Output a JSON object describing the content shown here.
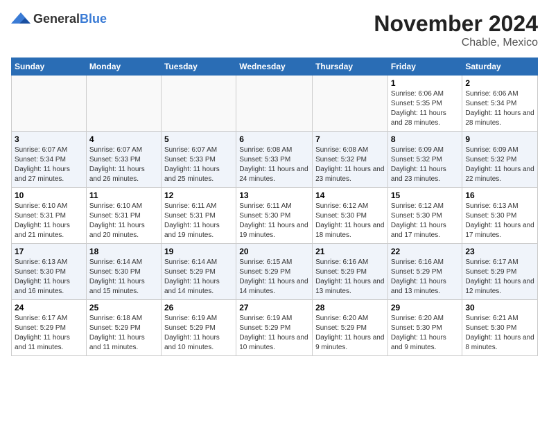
{
  "header": {
    "logo_general": "General",
    "logo_blue": "Blue",
    "month_year": "November 2024",
    "location": "Chable, Mexico"
  },
  "weekdays": [
    "Sunday",
    "Monday",
    "Tuesday",
    "Wednesday",
    "Thursday",
    "Friday",
    "Saturday"
  ],
  "weeks": [
    [
      {
        "day": "",
        "sunrise": "",
        "sunset": "",
        "daylight": ""
      },
      {
        "day": "",
        "sunrise": "",
        "sunset": "",
        "daylight": ""
      },
      {
        "day": "",
        "sunrise": "",
        "sunset": "",
        "daylight": ""
      },
      {
        "day": "",
        "sunrise": "",
        "sunset": "",
        "daylight": ""
      },
      {
        "day": "",
        "sunrise": "",
        "sunset": "",
        "daylight": ""
      },
      {
        "day": "1",
        "sunrise": "Sunrise: 6:06 AM",
        "sunset": "Sunset: 5:35 PM",
        "daylight": "Daylight: 11 hours and 28 minutes."
      },
      {
        "day": "2",
        "sunrise": "Sunrise: 6:06 AM",
        "sunset": "Sunset: 5:34 PM",
        "daylight": "Daylight: 11 hours and 28 minutes."
      }
    ],
    [
      {
        "day": "3",
        "sunrise": "Sunrise: 6:07 AM",
        "sunset": "Sunset: 5:34 PM",
        "daylight": "Daylight: 11 hours and 27 minutes."
      },
      {
        "day": "4",
        "sunrise": "Sunrise: 6:07 AM",
        "sunset": "Sunset: 5:33 PM",
        "daylight": "Daylight: 11 hours and 26 minutes."
      },
      {
        "day": "5",
        "sunrise": "Sunrise: 6:07 AM",
        "sunset": "Sunset: 5:33 PM",
        "daylight": "Daylight: 11 hours and 25 minutes."
      },
      {
        "day": "6",
        "sunrise": "Sunrise: 6:08 AM",
        "sunset": "Sunset: 5:33 PM",
        "daylight": "Daylight: 11 hours and 24 minutes."
      },
      {
        "day": "7",
        "sunrise": "Sunrise: 6:08 AM",
        "sunset": "Sunset: 5:32 PM",
        "daylight": "Daylight: 11 hours and 23 minutes."
      },
      {
        "day": "8",
        "sunrise": "Sunrise: 6:09 AM",
        "sunset": "Sunset: 5:32 PM",
        "daylight": "Daylight: 11 hours and 23 minutes."
      },
      {
        "day": "9",
        "sunrise": "Sunrise: 6:09 AM",
        "sunset": "Sunset: 5:32 PM",
        "daylight": "Daylight: 11 hours and 22 minutes."
      }
    ],
    [
      {
        "day": "10",
        "sunrise": "Sunrise: 6:10 AM",
        "sunset": "Sunset: 5:31 PM",
        "daylight": "Daylight: 11 hours and 21 minutes."
      },
      {
        "day": "11",
        "sunrise": "Sunrise: 6:10 AM",
        "sunset": "Sunset: 5:31 PM",
        "daylight": "Daylight: 11 hours and 20 minutes."
      },
      {
        "day": "12",
        "sunrise": "Sunrise: 6:11 AM",
        "sunset": "Sunset: 5:31 PM",
        "daylight": "Daylight: 11 hours and 19 minutes."
      },
      {
        "day": "13",
        "sunrise": "Sunrise: 6:11 AM",
        "sunset": "Sunset: 5:30 PM",
        "daylight": "Daylight: 11 hours and 19 minutes."
      },
      {
        "day": "14",
        "sunrise": "Sunrise: 6:12 AM",
        "sunset": "Sunset: 5:30 PM",
        "daylight": "Daylight: 11 hours and 18 minutes."
      },
      {
        "day": "15",
        "sunrise": "Sunrise: 6:12 AM",
        "sunset": "Sunset: 5:30 PM",
        "daylight": "Daylight: 11 hours and 17 minutes."
      },
      {
        "day": "16",
        "sunrise": "Sunrise: 6:13 AM",
        "sunset": "Sunset: 5:30 PM",
        "daylight": "Daylight: 11 hours and 17 minutes."
      }
    ],
    [
      {
        "day": "17",
        "sunrise": "Sunrise: 6:13 AM",
        "sunset": "Sunset: 5:30 PM",
        "daylight": "Daylight: 11 hours and 16 minutes."
      },
      {
        "day": "18",
        "sunrise": "Sunrise: 6:14 AM",
        "sunset": "Sunset: 5:30 PM",
        "daylight": "Daylight: 11 hours and 15 minutes."
      },
      {
        "day": "19",
        "sunrise": "Sunrise: 6:14 AM",
        "sunset": "Sunset: 5:29 PM",
        "daylight": "Daylight: 11 hours and 14 minutes."
      },
      {
        "day": "20",
        "sunrise": "Sunrise: 6:15 AM",
        "sunset": "Sunset: 5:29 PM",
        "daylight": "Daylight: 11 hours and 14 minutes."
      },
      {
        "day": "21",
        "sunrise": "Sunrise: 6:16 AM",
        "sunset": "Sunset: 5:29 PM",
        "daylight": "Daylight: 11 hours and 13 minutes."
      },
      {
        "day": "22",
        "sunrise": "Sunrise: 6:16 AM",
        "sunset": "Sunset: 5:29 PM",
        "daylight": "Daylight: 11 hours and 13 minutes."
      },
      {
        "day": "23",
        "sunrise": "Sunrise: 6:17 AM",
        "sunset": "Sunset: 5:29 PM",
        "daylight": "Daylight: 11 hours and 12 minutes."
      }
    ],
    [
      {
        "day": "24",
        "sunrise": "Sunrise: 6:17 AM",
        "sunset": "Sunset: 5:29 PM",
        "daylight": "Daylight: 11 hours and 11 minutes."
      },
      {
        "day": "25",
        "sunrise": "Sunrise: 6:18 AM",
        "sunset": "Sunset: 5:29 PM",
        "daylight": "Daylight: 11 hours and 11 minutes."
      },
      {
        "day": "26",
        "sunrise": "Sunrise: 6:19 AM",
        "sunset": "Sunset: 5:29 PM",
        "daylight": "Daylight: 11 hours and 10 minutes."
      },
      {
        "day": "27",
        "sunrise": "Sunrise: 6:19 AM",
        "sunset": "Sunset: 5:29 PM",
        "daylight": "Daylight: 11 hours and 10 minutes."
      },
      {
        "day": "28",
        "sunrise": "Sunrise: 6:20 AM",
        "sunset": "Sunset: 5:29 PM",
        "daylight": "Daylight: 11 hours and 9 minutes."
      },
      {
        "day": "29",
        "sunrise": "Sunrise: 6:20 AM",
        "sunset": "Sunset: 5:30 PM",
        "daylight": "Daylight: 11 hours and 9 minutes."
      },
      {
        "day": "30",
        "sunrise": "Sunrise: 6:21 AM",
        "sunset": "Sunset: 5:30 PM",
        "daylight": "Daylight: 11 hours and 8 minutes."
      }
    ]
  ]
}
